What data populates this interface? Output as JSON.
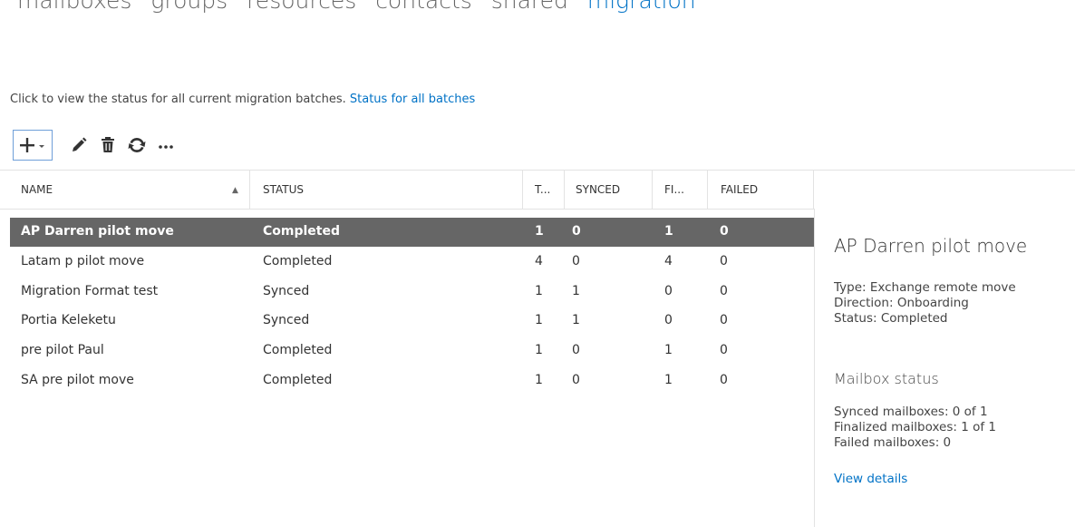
{
  "nav": {
    "items": [
      "mailboxes",
      "groups",
      "resources",
      "contacts",
      "shared",
      "migration"
    ],
    "active_index": 5
  },
  "info": {
    "text": "Click to view the status for all current migration batches.",
    "link": "Status for all batches"
  },
  "toolbar": {
    "icons": [
      "plus-icon",
      "chevron-down-icon",
      "pencil-icon",
      "trash-icon",
      "refresh-icon",
      "more-icon"
    ]
  },
  "table": {
    "columns": [
      "NAME",
      "STATUS",
      "T...",
      "SYNCED",
      "FI...",
      "FAILED"
    ],
    "sort": {
      "column": "NAME",
      "direction": "ascending"
    },
    "rows": [
      {
        "name": "AP Darren  pilot move",
        "status": "Completed",
        "total": "1",
        "synced": "0",
        "finalized": "1",
        "failed": "0",
        "selected": true
      },
      {
        "name": "Latam p pilot move",
        "status": "Completed",
        "total": "4",
        "synced": "0",
        "finalized": "4",
        "failed": "0"
      },
      {
        "name": "Migration Format test",
        "status": "Synced",
        "total": "1",
        "synced": "1",
        "finalized": "0",
        "failed": "0"
      },
      {
        "name": "Portia Keleketu",
        "status": "Synced",
        "total": "1",
        "synced": "1",
        "finalized": "0",
        "failed": "0"
      },
      {
        "name": "pre pilot Paul",
        "status": "Completed",
        "total": "1",
        "synced": "0",
        "finalized": "1",
        "failed": "0"
      },
      {
        "name": "SA pre pilot move",
        "status": "Completed",
        "total": "1",
        "synced": "0",
        "finalized": "1",
        "failed": "0"
      }
    ]
  },
  "details": {
    "title": "AP Darren pilot move",
    "type": "Type: Exchange remote move",
    "direction": "Direction: Onboarding",
    "status": "Status: Completed",
    "mailbox_heading": "Mailbox status",
    "synced": "Synced mailboxes: 0 of 1",
    "finalized": "Finalized mailboxes: 1 of 1",
    "failed": "Failed mailboxes: 0",
    "link": "View details"
  },
  "colors": {
    "accent": "#0072c6",
    "selected_row": "#666666"
  }
}
